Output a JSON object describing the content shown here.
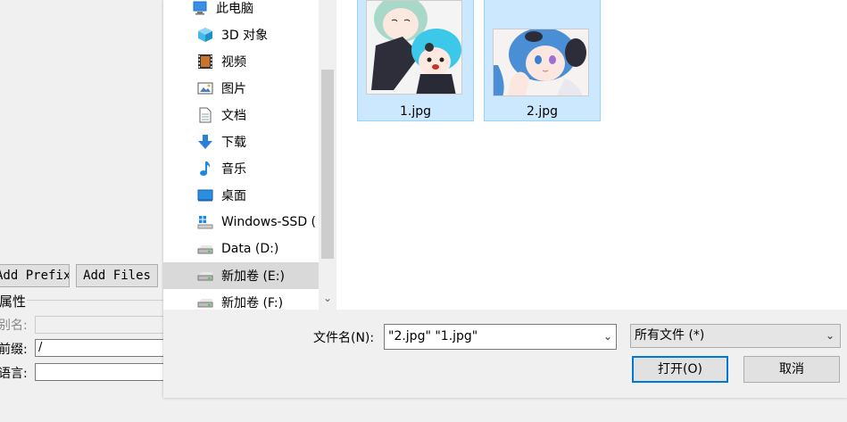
{
  "background_app": {
    "add_prefix_label": "Add Prefix",
    "add_files_label": "Add Files",
    "attributes_legend": "属性",
    "alias_label": "别名:",
    "prefix_label": "前缀:",
    "prefix_value": "/",
    "language_label": "语言:",
    "language_value": ""
  },
  "nav": {
    "items": [
      {
        "label": "此电脑",
        "icon": "pc-icon"
      },
      {
        "label": "3D 对象",
        "icon": "3d-objects-icon"
      },
      {
        "label": "视频",
        "icon": "video-icon"
      },
      {
        "label": "图片",
        "icon": "pictures-icon"
      },
      {
        "label": "文档",
        "icon": "documents-icon"
      },
      {
        "label": "下载",
        "icon": "download-icon"
      },
      {
        "label": "音乐",
        "icon": "music-icon"
      },
      {
        "label": "桌面",
        "icon": "desktop-icon"
      },
      {
        "label": "Windows-SSD (",
        "icon": "windows-drive-icon"
      },
      {
        "label": "Data (D:)",
        "icon": "drive-icon"
      },
      {
        "label": "新加卷 (E:)",
        "icon": "drive-icon",
        "selected": true
      },
      {
        "label": "新加卷 (F:)",
        "icon": "drive-icon"
      }
    ]
  },
  "files": [
    {
      "name": "1.jpg",
      "selected": true
    },
    {
      "name": "2.jpg",
      "selected": true
    }
  ],
  "bottom": {
    "filename_label": "文件名(N):",
    "filename_value": "\"2.jpg\" \"1.jpg\"",
    "filetype_value": "所有文件 (*)",
    "open_label": "打开(O)",
    "cancel_label": "取消"
  },
  "colors": {
    "selection_bg": "#cce8ff",
    "selection_border": "#99d1ff",
    "accent": "#0078d7"
  }
}
